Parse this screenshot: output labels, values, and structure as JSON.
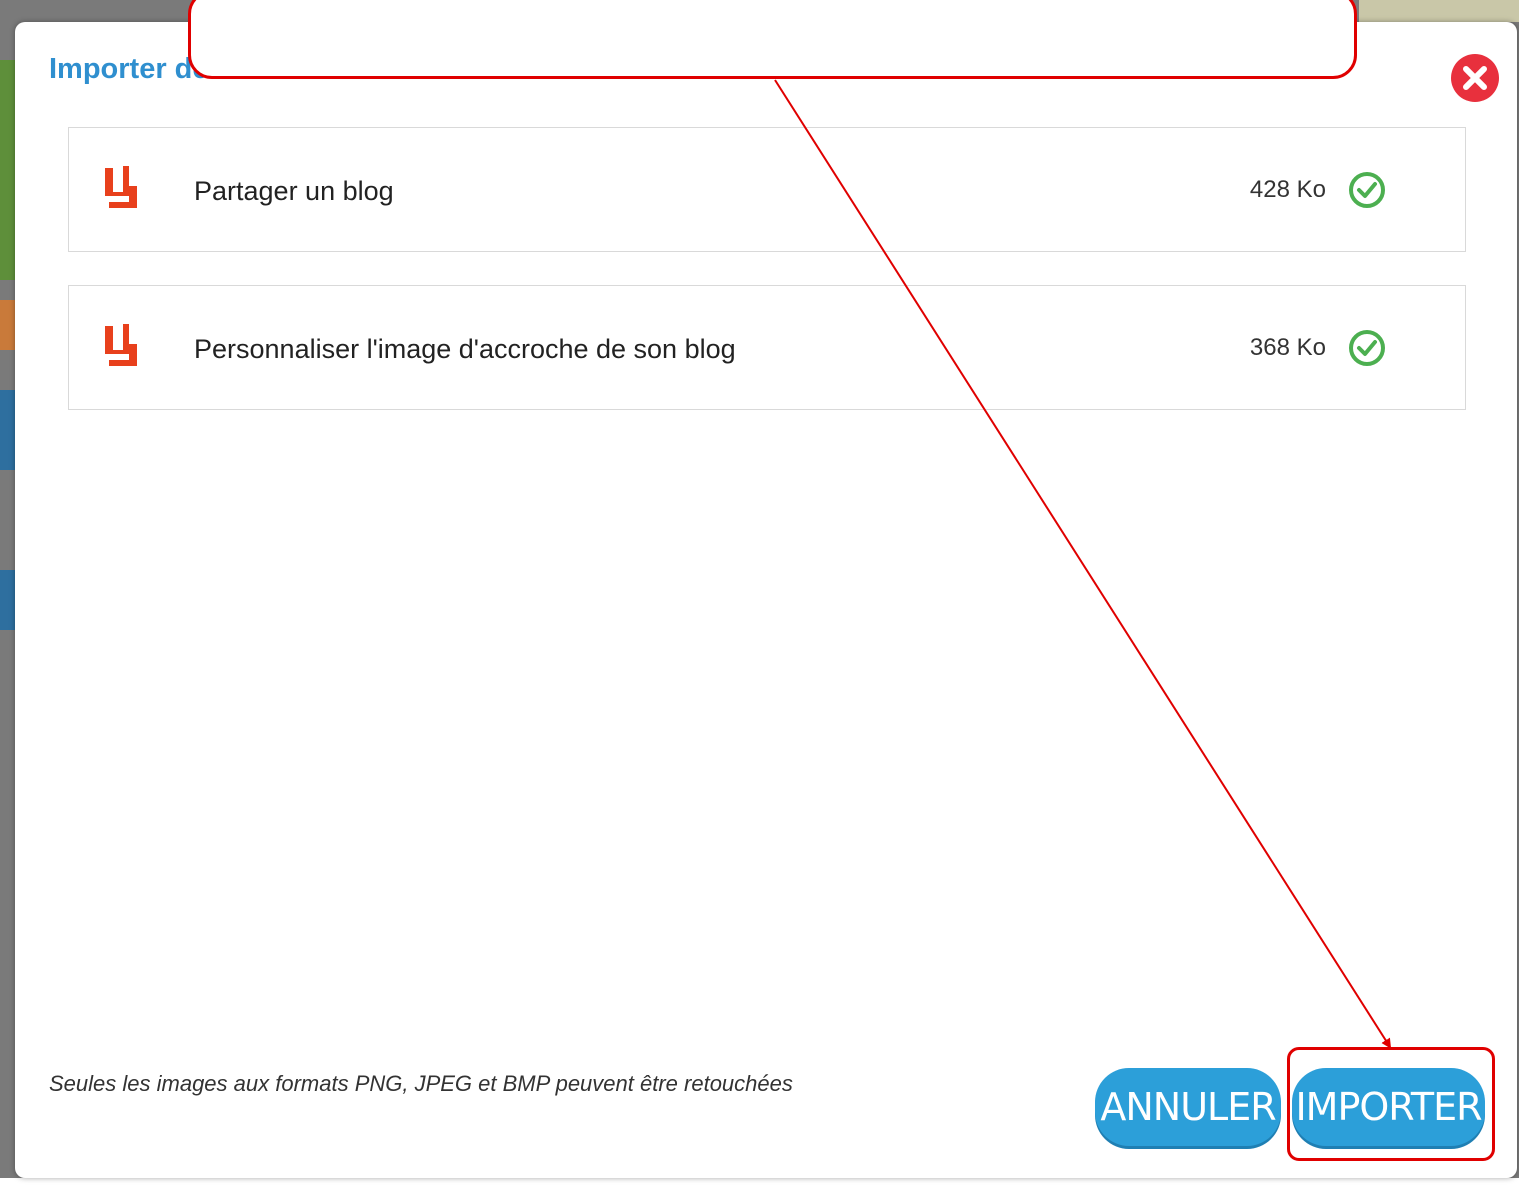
{
  "dialog": {
    "title": "Importer des documents",
    "close_icon": "close-circle-icon"
  },
  "files": [
    {
      "name": "Partager un blog",
      "size": "428 Ko",
      "type_icon": "document-file-icon",
      "status_icon": "check-circle-icon"
    },
    {
      "name": "Personnaliser l'image d'accroche de son blog",
      "size": "368 Ko",
      "type_icon": "document-file-icon",
      "status_icon": "check-circle-icon"
    }
  ],
  "footer": {
    "note": "Seules les images aux formats PNG, JPEG et BMP peuvent être retouchées",
    "cancel_label": "ANNULER",
    "import_label": "IMPORTER"
  },
  "colors": {
    "title": "#2f8fcf",
    "button": "#2c9fd9",
    "close": "#e8303d",
    "check": "#4caf50",
    "file_icon": "#e8401c",
    "annotation": "#e00000"
  }
}
